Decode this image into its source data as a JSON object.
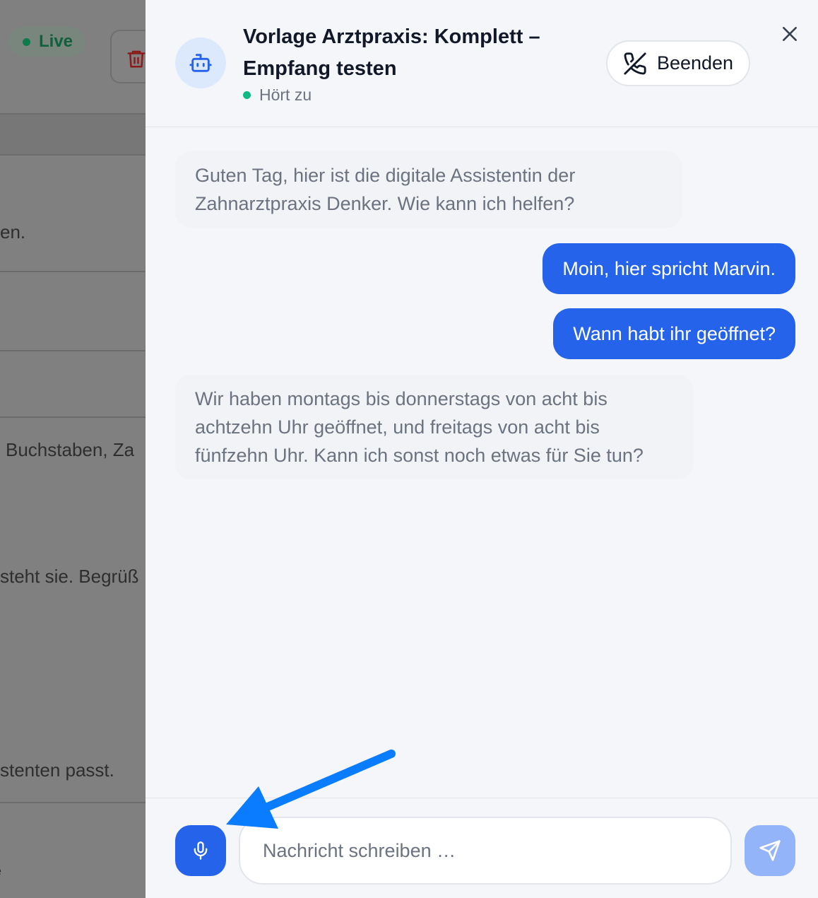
{
  "background": {
    "live_label": "Live",
    "fragments": [
      "en.",
      "Buchstaben, Za",
      "steht sie. Begrüß",
      "stenten passt.",
      "e"
    ],
    "icons": [
      "trash-icon"
    ]
  },
  "chat": {
    "title": "Vorlage Arztpraxis: Komplett – Empfang testen",
    "status": "Hört zu",
    "end_button": "Beenden",
    "icons": [
      "robot-icon",
      "phone-off-icon",
      "close-icon",
      "microphone-icon",
      "send-icon"
    ],
    "messages": [
      {
        "role": "assistant",
        "text": "Guten Tag, hier ist die digitale Assistentin der Zahnarztpraxis Denker. Wie kann ich helfen?"
      },
      {
        "role": "user",
        "text": "Moin, hier spricht Marvin."
      },
      {
        "role": "user",
        "text": "Wann habt ihr geöffnet?"
      },
      {
        "role": "assistant",
        "text": "Wir haben montags bis donnerstags von acht bis achtzehn Uhr geöffnet, und freitags von acht bis fünfzehn Uhr. Kann ich sonst noch etwas für Sie tun?"
      }
    ],
    "input": {
      "placeholder": "Nachricht schreiben …",
      "value": ""
    }
  },
  "colors": {
    "accent": "#2563eb",
    "send_disabled": "#93b4f8",
    "status_dot": "#10b981",
    "annotation_arrow": "#0a7cff"
  }
}
